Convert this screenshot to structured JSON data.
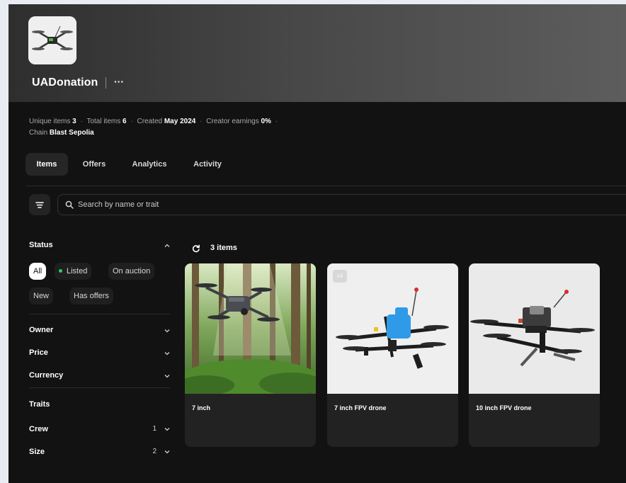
{
  "collection": {
    "name": "UADonation",
    "more_label": "···"
  },
  "stats": {
    "unique_label": "Unique items",
    "unique_value": "3",
    "total_label": "Total items",
    "total_value": "6",
    "created_label": "Created",
    "created_value": "May 2024",
    "earnings_label": "Creator earnings",
    "earnings_value": "0%",
    "chain_label": "Chain",
    "chain_value": "Blast Sepolia"
  },
  "tabs": [
    {
      "label": "Items"
    },
    {
      "label": "Offers"
    },
    {
      "label": "Analytics"
    },
    {
      "label": "Activity"
    }
  ],
  "search": {
    "placeholder": "Search by name or trait"
  },
  "filters": {
    "status_title": "Status",
    "status_chips": [
      "All",
      "Listed",
      "On auction",
      "New",
      "Has offers"
    ],
    "owner": "Owner",
    "price": "Price",
    "currency": "Currency",
    "traits_title": "Traits",
    "crew": {
      "label": "Crew",
      "count": "1"
    },
    "size": {
      "label": "Size",
      "count": "2"
    }
  },
  "items_count": "3 items",
  "items": [
    {
      "title": "7 inch"
    },
    {
      "title": "7 inch FPV drone",
      "badge": "x4"
    },
    {
      "title": "10 inch FPV drone"
    }
  ],
  "colors": {
    "background": "#121212",
    "listed_dot": "#2ecc71",
    "accent_blue": "#2f9be8",
    "antenna_red": "#d62d2d"
  }
}
